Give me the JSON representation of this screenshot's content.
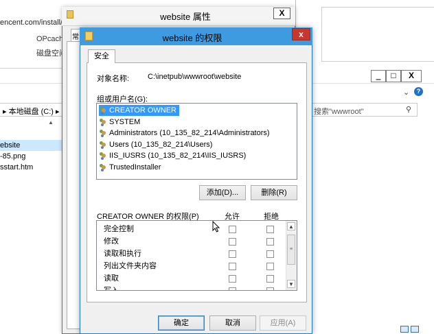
{
  "background_browser": {
    "url_fragment": "encent.com/install/i",
    "line1": "OPcach",
    "line2": "磁盘空间"
  },
  "explorer": {
    "minimize_label": "‗",
    "maximize_label": "□",
    "close_label": "X",
    "address_text": "▸ 本地磁盘 (C:) ▸ i",
    "search_placeholder": "搜索\"wwwroot\"",
    "files": [
      "ebsite",
      "-85.png",
      "sstart.htm"
    ],
    "chevron": "⌄",
    "help": "?"
  },
  "properties_dialog": {
    "title": "website 属性",
    "close_label": "X",
    "tab_fragment": "常"
  },
  "permissions_dialog": {
    "title": "website 的权限",
    "close_label": "x",
    "tab_security": "安全",
    "object_label": "对象名称:",
    "object_value": "C:\\inetpub\\wwwroot\\website",
    "group_label": "组或用户名(G):",
    "users": [
      "CREATOR OWNER",
      "SYSTEM",
      "Administrators (10_135_82_214\\Administrators)",
      "Users (10_135_82_214\\Users)",
      "IIS_IUSRS (10_135_82_214\\IIS_IUSRS)",
      "TrustedInstaller"
    ],
    "selected_user_index": 0,
    "add_button": "添加(D)...",
    "remove_button": "删除(R)",
    "permissions_for_label": "CREATOR OWNER 的权限(P)",
    "allow_header": "允许",
    "deny_header": "拒绝",
    "permissions": [
      "完全控制",
      "修改",
      "读取和执行",
      "列出文件夹内容",
      "读取",
      "写入"
    ],
    "ok_button": "确定",
    "cancel_button": "取消",
    "apply_button": "应用(A)"
  }
}
